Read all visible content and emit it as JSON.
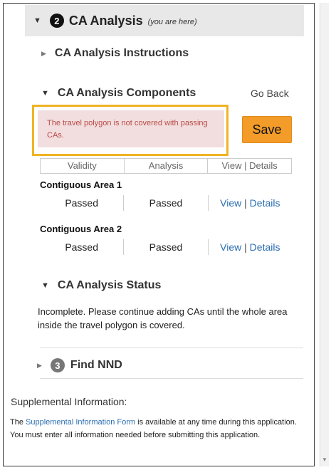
{
  "section2": {
    "number": "2",
    "title": "CA Analysis",
    "note": "(you are here)"
  },
  "instructions": {
    "label": "CA Analysis Instructions"
  },
  "components": {
    "label": "CA Analysis Components",
    "go_back": "Go Back",
    "alert": "The travel polygon is not covered with passing CAs.",
    "save_label": "Save",
    "columns": [
      "Validity",
      "Analysis",
      "View | Details"
    ],
    "areas": [
      {
        "title": "Contiguous Area 1",
        "validity": "Passed",
        "analysis": "Passed",
        "view": "View",
        "details": "Details"
      },
      {
        "title": "Contiguous Area 2",
        "validity": "Passed",
        "analysis": "Passed",
        "view": "View",
        "details": "Details"
      }
    ]
  },
  "status": {
    "label": "CA Analysis Status",
    "text": "Incomplete. Please continue adding CAs until the whole area inside the travel polygon is covered."
  },
  "section3": {
    "number": "3",
    "title": "Find NND"
  },
  "supplemental": {
    "title": "Supplemental Information:",
    "text_before": "The ",
    "link": "Supplemental Information Form",
    "text_after": " is available at any time during this application. You must enter all information needed before submitting this application."
  },
  "colors": {
    "accent_orange": "#f39c2a",
    "alert_bg": "#f2dede",
    "alert_text": "#b94a48",
    "highlight_outline": "#f0b323",
    "link": "#2a6db0"
  }
}
